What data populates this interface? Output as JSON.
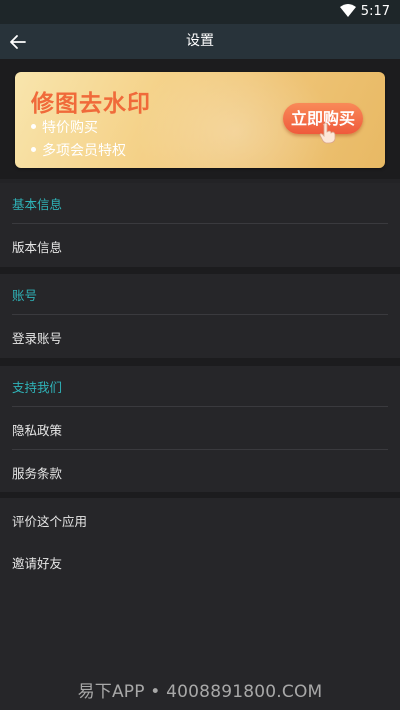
{
  "status_bar": {
    "time": "5:17",
    "wifi_icon": "wifi-icon"
  },
  "app_bar": {
    "title": "设置",
    "back_icon": "arrow-left-icon"
  },
  "banner": {
    "headline": "修图去水印",
    "bullets": [
      "特价购买",
      "多项会员特权"
    ],
    "button_label": "立即购买",
    "colors": {
      "headline": "#f06a3a",
      "button": "#ef5a3c",
      "background": "#f5d38b"
    }
  },
  "sections": [
    {
      "header": "基本信息",
      "items": [
        "版本信息"
      ]
    },
    {
      "header": "账号",
      "items": [
        "登录账号"
      ]
    },
    {
      "header": "支持我们",
      "items": [
        "隐私政策",
        "服务条款"
      ]
    },
    {
      "header": "",
      "items": [
        "评价这个应用",
        "邀请好友"
      ]
    }
  ],
  "accent_color": "#2fb3b8",
  "watermark": "易下APP • 4008891800.COM"
}
